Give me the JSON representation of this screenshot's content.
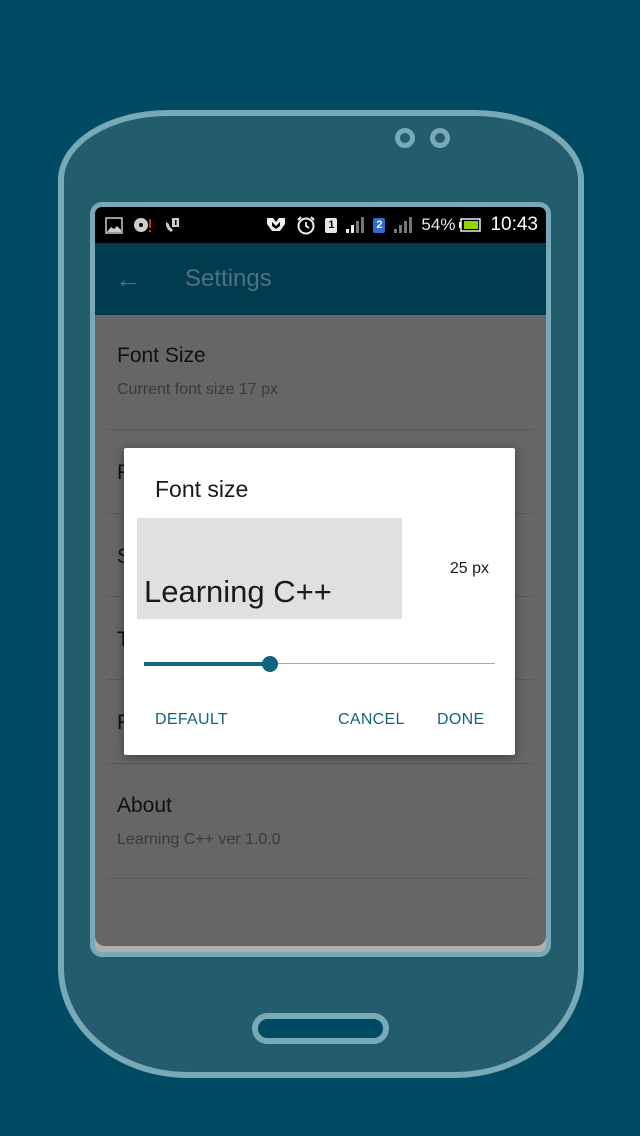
{
  "status_bar": {
    "left_icons": [
      "gallery-icon",
      "sync-alert-icon",
      "call-alert-icon"
    ],
    "right_icons": [
      "cast-icon",
      "alarm-icon",
      "sim1-signal-icon",
      "sim2-signal-icon",
      "battery-icon"
    ],
    "sim1_label": "1",
    "sim2_label": "2",
    "battery_percent": "54%",
    "time": "10:43"
  },
  "app_bar": {
    "back_icon": "←",
    "title": "Settings"
  },
  "settings": {
    "items": [
      {
        "title": "Font Size",
        "subtitle": "Current font size 17 px"
      },
      {
        "title": "F",
        "subtitle": ""
      },
      {
        "title": "S",
        "subtitle": ""
      },
      {
        "title": "T",
        "subtitle": ""
      },
      {
        "title": "F",
        "subtitle": ""
      },
      {
        "title": "About",
        "subtitle": "Learning C++ ver 1.0.0"
      }
    ]
  },
  "dialog": {
    "title": "Font size",
    "preview_text": "Learning C++",
    "size_value": "25 px",
    "slider_progress_percent": 36,
    "buttons": {
      "default": "DEFAULT",
      "cancel": "CANCEL",
      "done": "DONE"
    }
  },
  "colors": {
    "background": "#004a63",
    "app_bar": "#003b4f",
    "accent": "#0c6580",
    "overlay_gray": "#666666"
  }
}
